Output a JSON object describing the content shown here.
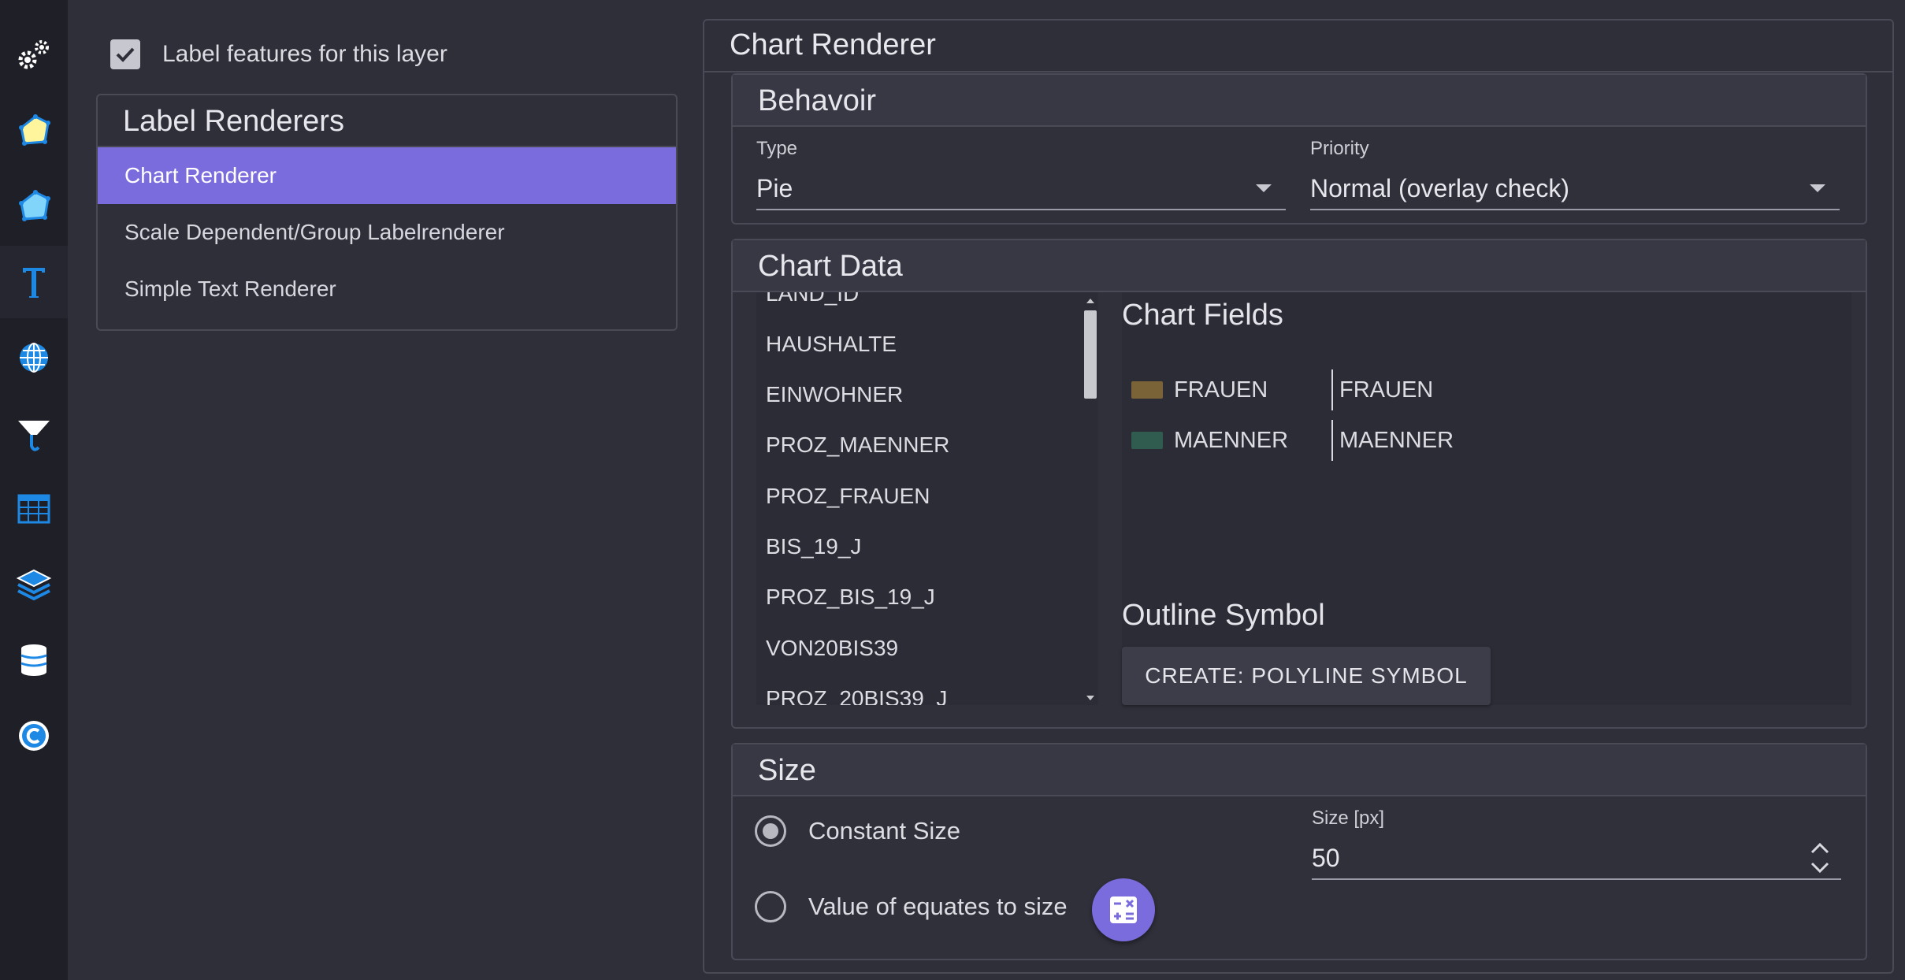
{
  "rail": {
    "items": [
      {
        "icon": "gears-icon"
      },
      {
        "icon": "polygon-fill-icon"
      },
      {
        "icon": "polygon-outline-icon"
      },
      {
        "icon": "text-label-icon",
        "active": true
      },
      {
        "icon": "globe-icon"
      },
      {
        "icon": "filter-icon"
      },
      {
        "icon": "table-icon"
      },
      {
        "icon": "layers-icon"
      },
      {
        "icon": "database-icon"
      },
      {
        "icon": "copyright-icon"
      }
    ]
  },
  "label_features": {
    "label": "Label features for this layer",
    "checked": true
  },
  "label_renderers": {
    "title": "Label Renderers",
    "items": [
      "Chart Renderer",
      "Scale Dependent/Group Labelrenderer",
      "Simple Text Renderer"
    ],
    "selected": "Chart Renderer"
  },
  "chart_renderer": {
    "title": "Chart Renderer",
    "behavior": {
      "title": "Behavoir",
      "type_label": "Type",
      "type_value": "Pie",
      "priority_label": "Priority",
      "priority_value": "Normal (overlay check)"
    },
    "chart_data": {
      "title": "Chart Data",
      "available_fields": [
        "LAND_ID",
        "HAUSHALTE",
        "EINWOHNER",
        "PROZ_MAENNER",
        "PROZ_FRAUEN",
        "BIS_19_J",
        "PROZ_BIS_19_J",
        "VON20BIS39",
        "PROZ_20BIS39_J"
      ],
      "chart_fields_heading": "Chart Fields",
      "chart_fields": [
        {
          "field": "FRAUEN",
          "label": "FRAUEN",
          "color": "#7a6337"
        },
        {
          "field": "MAENNER",
          "label": "MAENNER",
          "color": "#2f5c4e"
        }
      ],
      "outline_heading": "Outline Symbol",
      "outline_button": "CREATE: POLYLINE SYMBOL"
    },
    "size": {
      "title": "Size",
      "constant_label": "Constant Size",
      "value_label": "Value of equates to size",
      "selected": "constant",
      "size_label": "Size [px]",
      "size_value": "50"
    }
  },
  "colors": {
    "accent": "#7b6cde",
    "background": "#2f2f3a",
    "rail": "#1f1f27",
    "icon_blue": "#1e88e5",
    "icon_yellow": "#fff59d",
    "icon_cyan": "#81d4fa"
  }
}
